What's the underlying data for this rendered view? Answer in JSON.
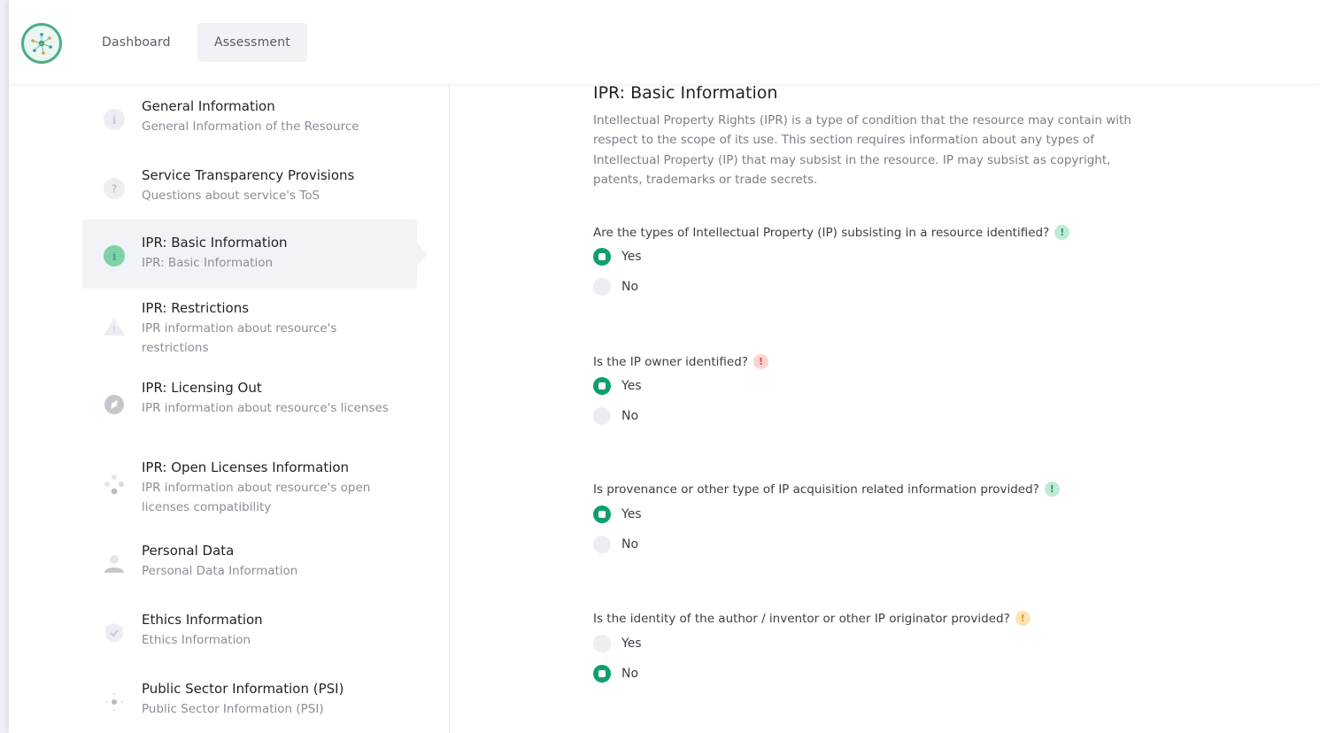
{
  "nav": {
    "dashboard": "Dashboard",
    "assessment": "Assessment"
  },
  "sidebar": {
    "items": [
      {
        "title": "General Information",
        "subtitle": "General Information of the Resource",
        "icon": "info-icon"
      },
      {
        "title": "Service Transparency Provisions",
        "subtitle": "Questions about service's ToS",
        "icon": "question-icon"
      },
      {
        "title": "IPR: Basic Information",
        "subtitle": "IPR: Basic Information",
        "icon": "info-icon",
        "active": true
      },
      {
        "title": "IPR: Restrictions",
        "subtitle": "IPR information about resource's restrictions",
        "icon": "warning-icon"
      },
      {
        "title": "IPR: Licensing Out",
        "subtitle": "IPR information about resource's licenses",
        "icon": "compass-icon"
      },
      {
        "title": "IPR: Open Licenses Information",
        "subtitle": "IPR information about resource's open licenses compatibility",
        "icon": "diamond-dots-icon"
      },
      {
        "title": "Personal Data",
        "subtitle": "Personal Data Information",
        "icon": "person-icon"
      },
      {
        "title": "Ethics Information",
        "subtitle": "Ethics Information",
        "icon": "shield-check-icon"
      },
      {
        "title": "Public Sector Information (PSI)",
        "subtitle": "Public Sector Information (PSI)",
        "icon": "dots-cross-icon"
      }
    ]
  },
  "main": {
    "title": "IPR: Basic Information",
    "description": "Intellectual Property Rights (IPR) is a type of condition that the resource may contain with respect to the scope of its use. This section requires information about any types of Intellectual Property (IP) that may subsist in the resource. IP may subsist as copyright, patents, trademarks or trade secrets.",
    "questions": [
      {
        "text": "Are the types of Intellectual Property (IP) subsisting in a resource identified?",
        "badge": "!",
        "badge_color": "#34c38f",
        "options": [
          "Yes",
          "No"
        ],
        "selected": "Yes"
      },
      {
        "text": "Is the IP owner identified?",
        "badge": "!",
        "badge_color": "#f46a6a",
        "options": [
          "Yes",
          "No"
        ],
        "selected": "Yes"
      },
      {
        "text": "Is provenance or other type of IP acquisition related information provided?",
        "badge": "!",
        "badge_color": "#34c38f",
        "options": [
          "Yes",
          "No"
        ],
        "selected": "Yes"
      },
      {
        "text": "Is the identity of the author / inventor or other IP originator provided?",
        "badge": "!",
        "badge_color": "#f1b44c",
        "options": [
          "Yes",
          "No"
        ],
        "selected": "No"
      }
    ]
  },
  "colors": {
    "accent": "#0e9f6e",
    "logo_ring": "#4cae86"
  }
}
